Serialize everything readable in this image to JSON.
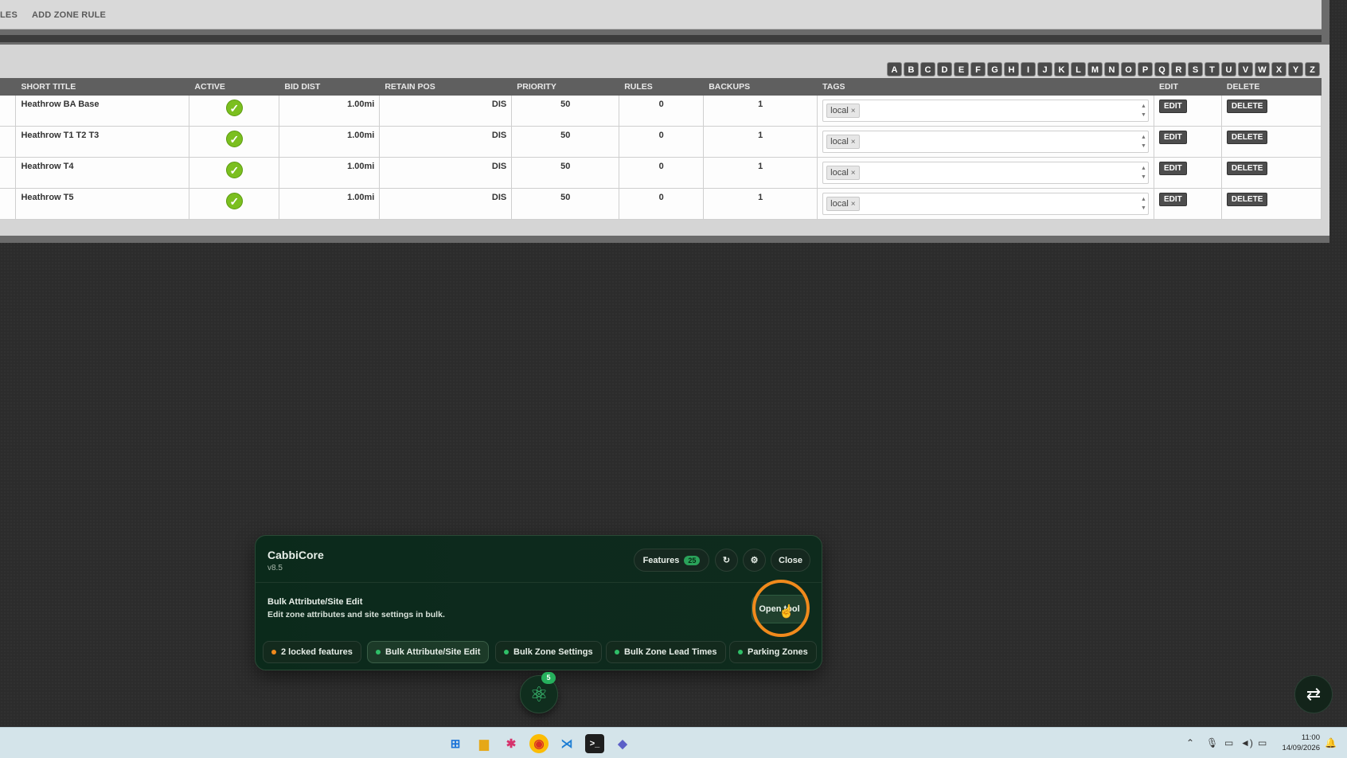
{
  "nav": {
    "items": [
      "LES",
      "ADD ZONE RULE"
    ]
  },
  "alphabet": [
    "A",
    "B",
    "C",
    "D",
    "E",
    "F",
    "G",
    "H",
    "I",
    "J",
    "K",
    "L",
    "M",
    "N",
    "O",
    "P",
    "Q",
    "R",
    "S",
    "T",
    "U",
    "V",
    "W",
    "X",
    "Y",
    "Z"
  ],
  "table": {
    "headers": {
      "short_title": "SHORT TITLE",
      "active": "ACTIVE",
      "bid_dist": "BID DIST",
      "retain_pos": "RETAIN POS",
      "priority": "PRIORITY",
      "rules": "RULES",
      "backups": "BACKUPS",
      "tags": "TAGS",
      "edit": "EDIT",
      "delete": "DELETE"
    },
    "rows": [
      {
        "title": "Heathrow BA Base",
        "bid_dist": "1.00mi",
        "retain_pos": "DIS",
        "priority": "50",
        "rules": "0",
        "backups": "1",
        "tag": "local",
        "edit": "EDIT",
        "delete": "DELETE"
      },
      {
        "title": "Heathrow T1 T2 T3",
        "bid_dist": "1.00mi",
        "retain_pos": "DIS",
        "priority": "50",
        "rules": "0",
        "backups": "1",
        "tag": "local",
        "edit": "EDIT",
        "delete": "DELETE"
      },
      {
        "title": "Heathrow T4",
        "bid_dist": "1.00mi",
        "retain_pos": "DIS",
        "priority": "50",
        "rules": "0",
        "backups": "1",
        "tag": "local",
        "edit": "EDIT",
        "delete": "DELETE"
      },
      {
        "title": "Heathrow T5",
        "bid_dist": "1.00mi",
        "retain_pos": "DIS",
        "priority": "50",
        "rules": "0",
        "backups": "1",
        "tag": "local",
        "edit": "EDIT",
        "delete": "DELETE"
      }
    ]
  },
  "cabbi": {
    "title": "CabbiCore",
    "version": "v8.5",
    "features_label": "Features",
    "features_count": "25",
    "close_label": "Close",
    "feature_title": "Bulk Attribute/Site Edit",
    "feature_desc": "Edit zone attributes and site settings in bulk.",
    "open_label": "Open tool",
    "chips": [
      "2 locked features",
      "Bulk Attribute/Site Edit",
      "Bulk Zone Settings",
      "Bulk Zone Lead Times",
      "Parking Zones"
    ],
    "launcher_badge": "5"
  },
  "taskbar": {
    "time": "11:00",
    "date": "14/09/2026"
  },
  "colors": {
    "accent_green": "#2aa25a",
    "highlight_ring": "#f08a1c",
    "check_green": "#7bbf1f"
  }
}
